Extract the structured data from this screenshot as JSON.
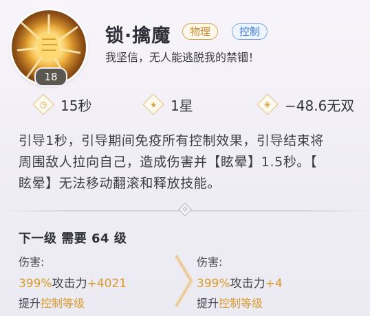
{
  "skill": {
    "level": "18",
    "name": "锁·擒魔",
    "tags": [
      "物理",
      "控制"
    ],
    "quote": "我坚信，无人能逃脱我的禁锢！",
    "icon": "glowing-fist-icon"
  },
  "stats": {
    "cooldown": "15秒",
    "stars": "1星",
    "musou": "−48.6无双"
  },
  "description": {
    "line1": "引导1秒，引导期间免疫所有控制效果，引导结束将",
    "line2": "周围敌人拉向自己，造成伤害并【眩晕】1.5秒。【",
    "line3": "眩晕】无法移动翻滚和释放技能。"
  },
  "upgrade": {
    "next_level": "下一级 需要 64 级",
    "current": {
      "damage_label": "伤害:",
      "damage_pct": "399%",
      "damage_rest": "攻击力",
      "damage_plus": "+4021",
      "upgrade_prefix": "提升",
      "upgrade_highlight": "控制等级"
    },
    "next": {
      "damage_label": "伤害:",
      "damage_pct": "399%",
      "damage_rest": "攻击力",
      "damage_plus": "+4",
      "upgrade_prefix": "提升",
      "upgrade_highlight": "控制等级"
    }
  },
  "colors": {
    "accent": "#d89a2c",
    "physical_tag": "#c68a2e",
    "control_tag": "#3b7bd6"
  }
}
